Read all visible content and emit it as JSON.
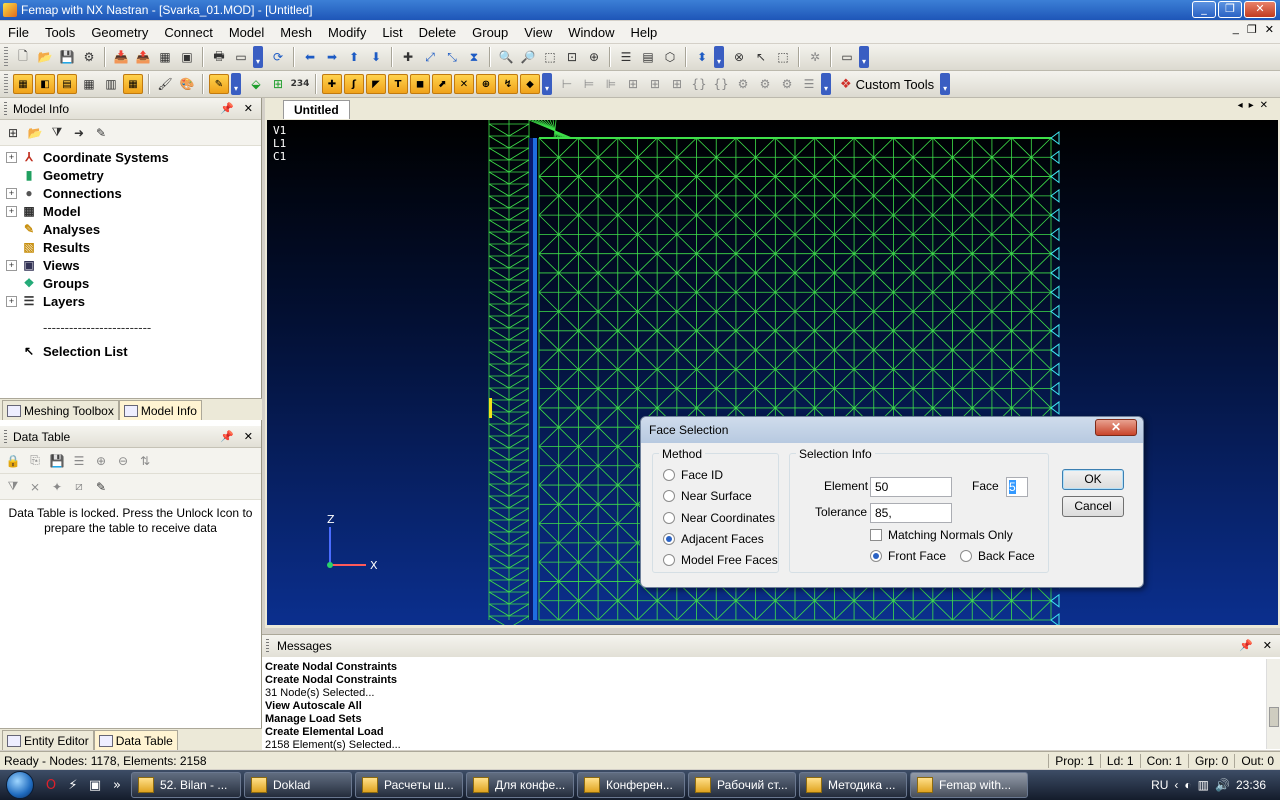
{
  "window": {
    "title": "Femap with NX Nastran - [Svarka_01.MOD] - [Untitled]",
    "controls": [
      "_",
      "❐",
      "✕"
    ]
  },
  "menu": [
    "File",
    "Tools",
    "Geometry",
    "Connect",
    "Model",
    "Mesh",
    "Modify",
    "List",
    "Delete",
    "Group",
    "View",
    "Window",
    "Help"
  ],
  "toolbar2": {
    "custom_tools_label": "Custom Tools",
    "number_icon": "234"
  },
  "model_info": {
    "title": "Model Info",
    "tree": [
      {
        "label": "Coordinate Systems",
        "icon": "coordinate-systems-icon",
        "expandable": true
      },
      {
        "label": "Geometry",
        "icon": "geometry-icon",
        "expandable": false
      },
      {
        "label": "Connections",
        "icon": "connections-icon",
        "expandable": true
      },
      {
        "label": "Model",
        "icon": "model-icon",
        "expandable": true
      },
      {
        "label": "Analyses",
        "icon": "analyses-icon",
        "expandable": false
      },
      {
        "label": "Results",
        "icon": "results-icon",
        "expandable": false
      },
      {
        "label": "Views",
        "icon": "views-icon",
        "expandable": true
      },
      {
        "label": "Groups",
        "icon": "groups-icon",
        "expandable": false
      },
      {
        "label": "Layers",
        "icon": "layers-icon",
        "expandable": true
      },
      {
        "label": "-------------------------",
        "icon": "",
        "expandable": false
      },
      {
        "label": "Selection List",
        "icon": "selection-list-icon",
        "expandable": false
      }
    ]
  },
  "left_tabs_top": [
    "Meshing Toolbox",
    "Model Info"
  ],
  "data_table": {
    "title": "Data Table",
    "locked_message": "Data Table is locked. Press the Unlock Icon to prepare the table to receive data"
  },
  "left_tabs_bottom": [
    "Entity Editor",
    "Data Table"
  ],
  "document": {
    "tab": "Untitled",
    "view_labels": [
      "V1",
      "L1",
      "C1"
    ],
    "axis": {
      "z": "Z",
      "x": "X"
    },
    "mesh_color": "#3ee04a",
    "constraint_color": "#3fe6f0"
  },
  "dialog": {
    "title": "Face Selection",
    "method_label": "Method",
    "methods": [
      {
        "label": "Face ID",
        "selected": false
      },
      {
        "label": "Near Surface",
        "selected": false
      },
      {
        "label": "Near Coordinates",
        "selected": false
      },
      {
        "label": "Adjacent Faces",
        "selected": true
      },
      {
        "label": "Model Free Faces",
        "selected": false
      }
    ],
    "info_label": "Selection Info",
    "element_label": "Element",
    "element_value": "50",
    "face_label": "Face",
    "face_value": "5",
    "tolerance_label": "Tolerance",
    "tolerance_value": "85,",
    "matching_normals": "Matching Normals Only",
    "matching_normals_checked": false,
    "front_face": "Front Face",
    "back_face": "Back Face",
    "front_selected": true,
    "ok": "OK",
    "cancel": "Cancel"
  },
  "messages": {
    "title": "Messages",
    "lines": [
      {
        "text": "Create Nodal Constraints",
        "bold": true
      },
      {
        "text": "Create Nodal Constraints",
        "bold": true
      },
      {
        "text": "31 Node(s) Selected...",
        "bold": false
      },
      {
        "text": "View Autoscale All",
        "bold": true
      },
      {
        "text": "Manage Load Sets",
        "bold": true
      },
      {
        "text": "Create Elemental Load",
        "bold": true
      },
      {
        "text": "2158 Element(s) Selected...",
        "bold": false
      }
    ]
  },
  "status": {
    "left": "Ready - Nodes: 1178,  Elements: 2158",
    "prop": "Prop: 1",
    "ld": "Ld: 1",
    "con": "Con: 1",
    "grp": "Grp: 0",
    "out": "Out: 0"
  },
  "taskbar": {
    "tasks": [
      "52. Bilan - ...",
      "Doklad",
      "Расчеты ш...",
      "Для конфе...",
      "Конферен...",
      "Рабочий ст...",
      "Методика ...",
      "Femap with..."
    ],
    "active_task": 7,
    "lang": "RU",
    "time": "23:36"
  }
}
